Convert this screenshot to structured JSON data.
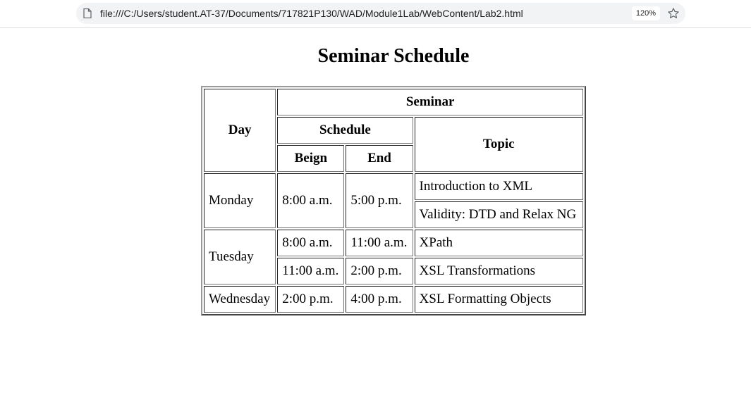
{
  "browser": {
    "url": "file:///C:/Users/student.AT-37/Documents/717821P130/WAD/Module1Lab/WebContent/Lab2.html",
    "zoom": "120%",
    "icons": [
      "file-icon",
      "star-icon"
    ]
  },
  "page": {
    "title": "Seminar Schedule"
  },
  "table": {
    "headers": {
      "day": "Day",
      "seminar": "Seminar",
      "schedule": "Schedule",
      "topic": "Topic",
      "begin": "Beign",
      "end": "End"
    },
    "rows": [
      {
        "day": "Monday",
        "begin": "8:00 a.m.",
        "end": "5:00 p.m.",
        "topics": [
          "Introduction to XML",
          "Validity: DTD and Relax NG"
        ]
      },
      {
        "day": "Tuesday",
        "slots": [
          {
            "begin": "8:00 a.m.",
            "end": "11:00 a.m.",
            "topic": "XPath"
          },
          {
            "begin": "11:00 a.m.",
            "end": "2:00 p.m.",
            "topic": "XSL Transformations"
          }
        ]
      },
      {
        "day": "Wednesday",
        "begin": "2:00 p.m.",
        "end": "4:00 p.m.",
        "topic": "XSL Formatting Objects"
      }
    ]
  }
}
